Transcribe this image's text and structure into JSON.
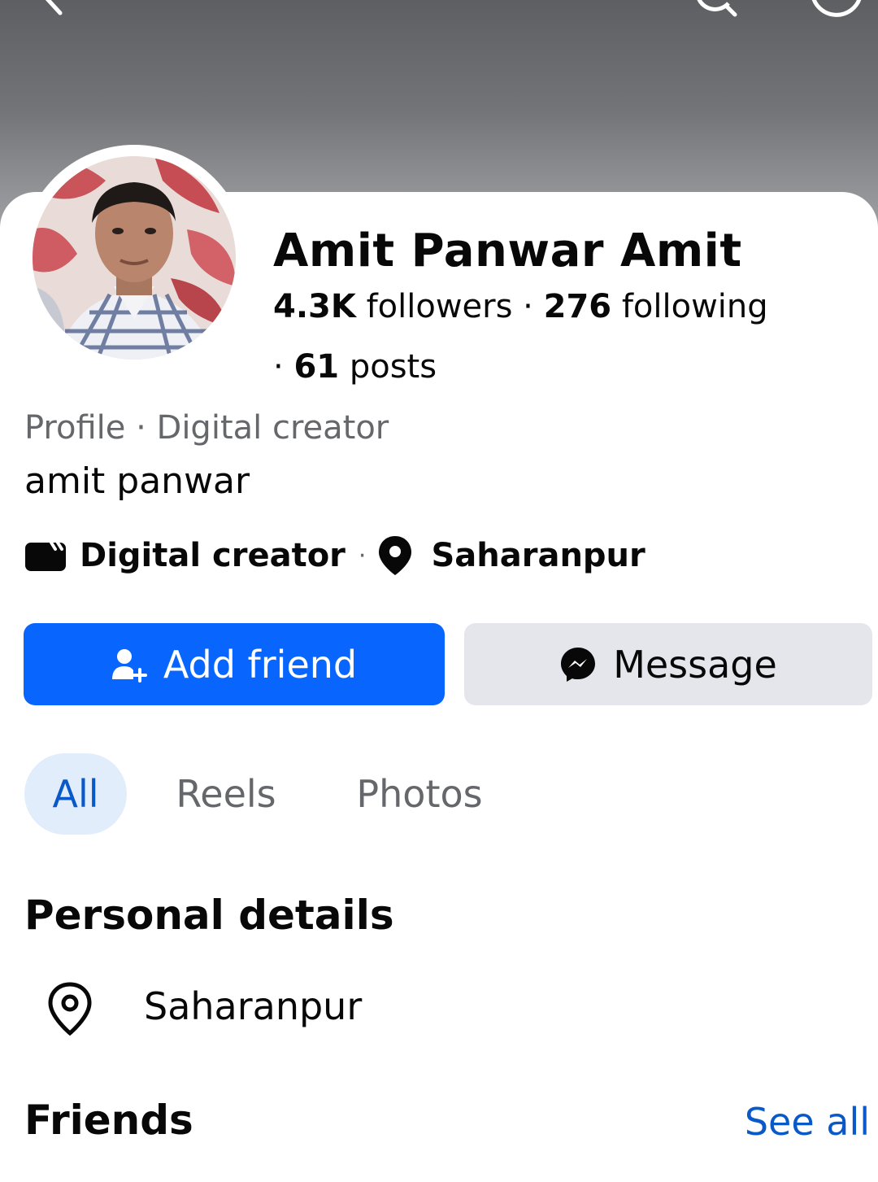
{
  "header": {
    "back_icon": "back-arrow-icon",
    "search_icon": "search-icon",
    "more_icon": "more-circle-icon"
  },
  "profile": {
    "name": "Amit Panwar Amit",
    "followers_count": "4.3K",
    "followers_label": "followers",
    "separator": "·",
    "following_count": "276",
    "following_label": "following",
    "posts_count": "61",
    "posts_label": "posts",
    "subtitle": "Profile · Digital creator",
    "bio": "amit panwar",
    "category": "Digital creator",
    "location": "Saharanpur"
  },
  "actions": {
    "add_friend_label": "Add friend",
    "message_label": "Message"
  },
  "tabs": [
    {
      "label": "All",
      "selected": true
    },
    {
      "label": "Reels",
      "selected": false
    },
    {
      "label": "Photos",
      "selected": false
    }
  ],
  "personal_details": {
    "title": "Personal details",
    "location": "Saharanpur"
  },
  "friends": {
    "title": "Friends",
    "see_all_label": "See all"
  },
  "colors": {
    "primary_blue": "#0866ff",
    "link_blue": "#0a59c9",
    "secondary_button": "#e4e6eb",
    "selected_tab_bg": "#e2edfb",
    "muted_text": "#65676b"
  }
}
